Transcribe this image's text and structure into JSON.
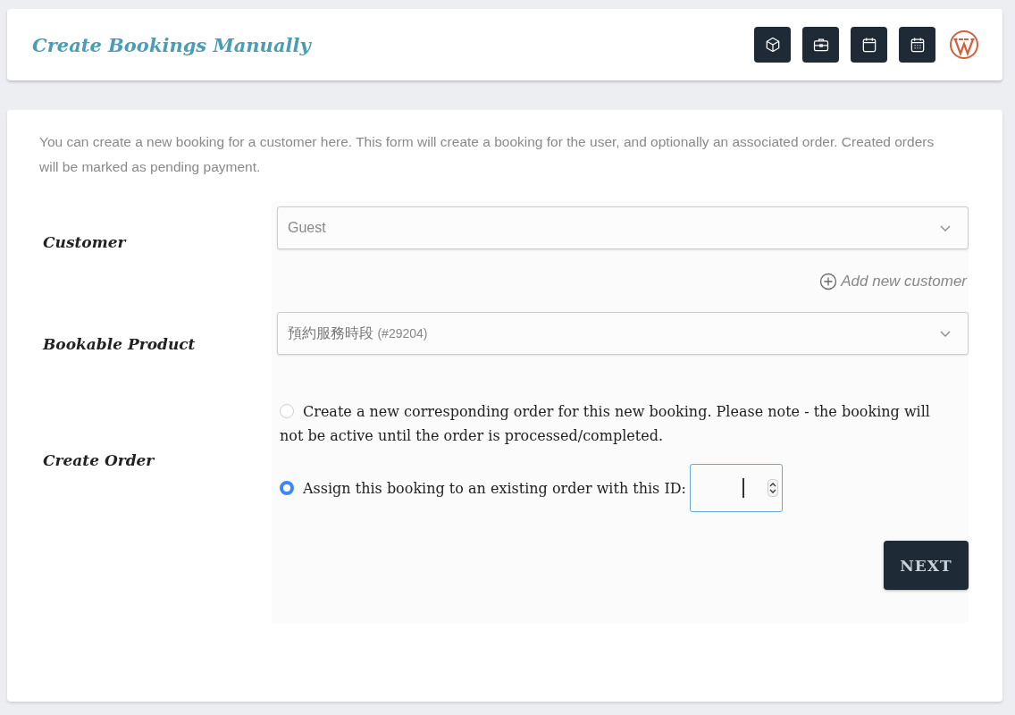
{
  "header": {
    "title": "Create Bookings Manually",
    "icons": [
      {
        "kind": "cube"
      },
      {
        "kind": "briefcase"
      },
      {
        "kind": "calendar"
      },
      {
        "kind": "calendar-grid"
      },
      {
        "kind": "logo"
      }
    ]
  },
  "intro": "You can create a new booking for a customer here. This form will create a booking for the user, and optionally an associated order. Created orders will be marked as pending payment.",
  "customer": {
    "label": "Customer",
    "value": "Guest",
    "add_link": "Add new customer"
  },
  "product": {
    "label": "Bookable Product",
    "value": "預約服務時段",
    "suffix": "(#29204)"
  },
  "order": {
    "label": "Create Order",
    "options": [
      {
        "label": "Create a new corresponding order for this new booking. Please note - the booking will not be active until the order is processed/completed.",
        "selected": false,
        "kind": "plain"
      },
      {
        "label": "Assign this booking to an existing order with this ID:",
        "selected": true,
        "kind": "id_input"
      }
    ]
  },
  "next_button": "NEXT"
}
